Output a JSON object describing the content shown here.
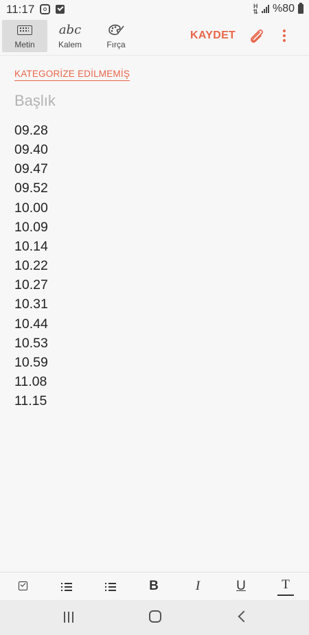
{
  "status_bar": {
    "time": "11:17",
    "network_type": "H",
    "battery_text": "%80",
    "icons": [
      "instagram-icon",
      "checkbox-notification-icon",
      "network-h-icon",
      "signal-icon",
      "battery-icon"
    ]
  },
  "toolbar": {
    "modes": [
      {
        "label": "Metin",
        "icon": "keyboard-icon",
        "active": true
      },
      {
        "label": "Kalem",
        "icon": "abc-handwriting-icon",
        "glyph": "abc",
        "active": false
      },
      {
        "label": "Fırça",
        "icon": "palette-brush-icon",
        "active": false
      }
    ],
    "save_label": "KAYDET",
    "attach_icon": "paperclip-icon",
    "more_icon": "more-vertical-icon",
    "accent_color": "#e8664a"
  },
  "note": {
    "category": "KATEGORİZE EDİLMEMİŞ",
    "title_placeholder": "Başlık",
    "lines": [
      "09.28",
      "09.40",
      "09.47",
      "09.52",
      "10.00",
      "10.09",
      "10.14",
      "10.22",
      "10.27",
      "10.31",
      "10.44",
      "10.53",
      "10.59",
      "11.08",
      "11.15"
    ]
  },
  "format_bar": {
    "items": [
      {
        "name": "checkbox-icon"
      },
      {
        "name": "numbered-list-icon"
      },
      {
        "name": "bulleted-list-icon"
      },
      {
        "name": "bold-icon",
        "glyph": "B"
      },
      {
        "name": "italic-icon",
        "glyph": "I"
      },
      {
        "name": "underline-icon",
        "glyph": "U"
      },
      {
        "name": "text-color-icon",
        "glyph": "T"
      }
    ]
  },
  "nav_bar": {
    "icons": [
      "recent-apps-icon",
      "home-icon",
      "back-icon"
    ]
  }
}
